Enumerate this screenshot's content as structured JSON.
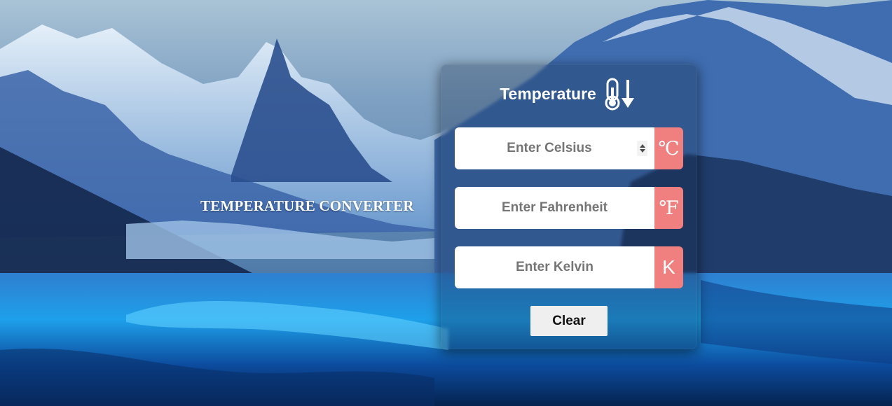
{
  "page": {
    "headline": "TEMPERATURE CONVERTER"
  },
  "card": {
    "title": "Temperature",
    "title_icon": "thermometer-arrow-down-icon"
  },
  "fields": [
    {
      "placeholder": "Enter Celsius",
      "value": "",
      "unit": "℃",
      "type": "number"
    },
    {
      "placeholder": "Enter Fahrenheit",
      "value": "",
      "unit": "℉",
      "type": "text"
    },
    {
      "placeholder": "Enter Kelvin",
      "value": "",
      "unit": "K",
      "type": "text"
    }
  ],
  "actions": {
    "clear_label": "Clear"
  },
  "colors": {
    "unit_badge": "#f07f7f",
    "input_bg": "#ffffff",
    "placeholder": "#757575",
    "button_bg": "#efefef"
  }
}
